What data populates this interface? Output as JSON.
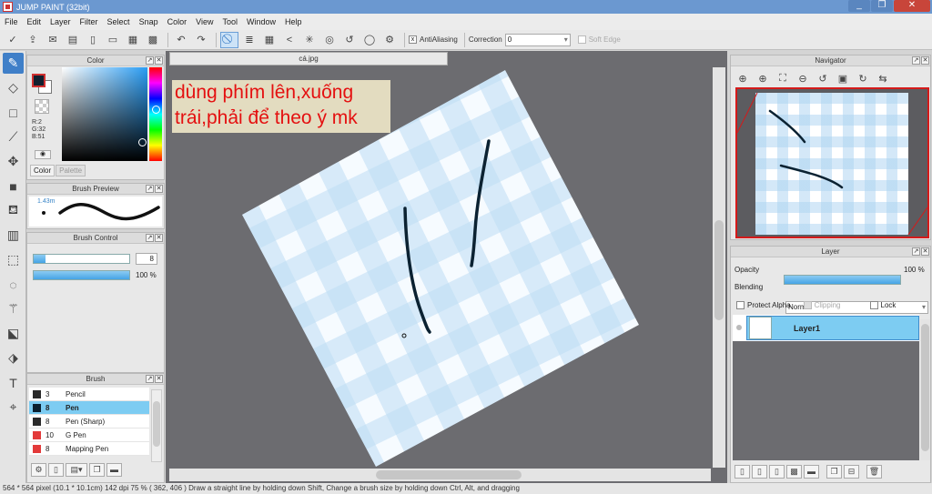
{
  "window": {
    "title": "JUMP PAINT (32bit)",
    "min": "_",
    "max": "❐",
    "close": "✕"
  },
  "menu": [
    "File",
    "Edit",
    "Layer",
    "Filter",
    "Select",
    "Snap",
    "Color",
    "View",
    "Tool",
    "Window",
    "Help"
  ],
  "toolbar": {
    "antialiasing_label": "AntiAliasing",
    "antialiasing_checked": "x",
    "correction_label": "Correction",
    "correction_value": "0",
    "soft_edge_label": "Soft Edge"
  },
  "color_panel": {
    "title": "Color",
    "r": "R:2",
    "g": "G:32",
    "b": "B:51",
    "tab_color": "Color",
    "tab_palette": "Palette",
    "fg": "#021f33",
    "bg": "#ffffff"
  },
  "brush_preview": {
    "title": "Brush Preview",
    "size": "1.43m"
  },
  "brush_control": {
    "title": "Brush Control",
    "size_value": "8",
    "opacity_value": "100 %",
    "opacity_fill": 1.0,
    "size_fill": 0.12
  },
  "brush_list": {
    "title": "Brush",
    "items": [
      {
        "size": "3",
        "name": "Pencil",
        "color": "#2a2a2a"
      },
      {
        "size": "8",
        "name": "Pen",
        "color": "#0a2030",
        "selected": true
      },
      {
        "size": "8",
        "name": "Pen (Sharp)",
        "color": "#2a2a2a"
      },
      {
        "size": "10",
        "name": "G Pen",
        "color": "#e33a3a"
      },
      {
        "size": "8",
        "name": "Mapping Pen",
        "color": "#e33a3a"
      }
    ]
  },
  "document": {
    "tab": "cá.jpg"
  },
  "overlay_text": {
    "line1": "dùng phím lên,xuống",
    "line2": "trái,phải để theo ý mk"
  },
  "navigator": {
    "title": "Navigator"
  },
  "layer_panel": {
    "title": "Layer",
    "opacity_label": "Opacity",
    "opacity_value": "100 %",
    "blending_label": "Blending",
    "blending_value": "Normal",
    "protect_alpha": "Protect Alpha",
    "clipping": "Clipping",
    "lock": "Lock",
    "layer_name": "Layer1"
  },
  "status": "564 * 564 pixel   (10.1 * 10.1cm)   142 dpi   75 %   ( 362, 406 )   Draw a straight line by holding down Shift, Change a brush size by holding down Ctrl, Alt, and dragging"
}
